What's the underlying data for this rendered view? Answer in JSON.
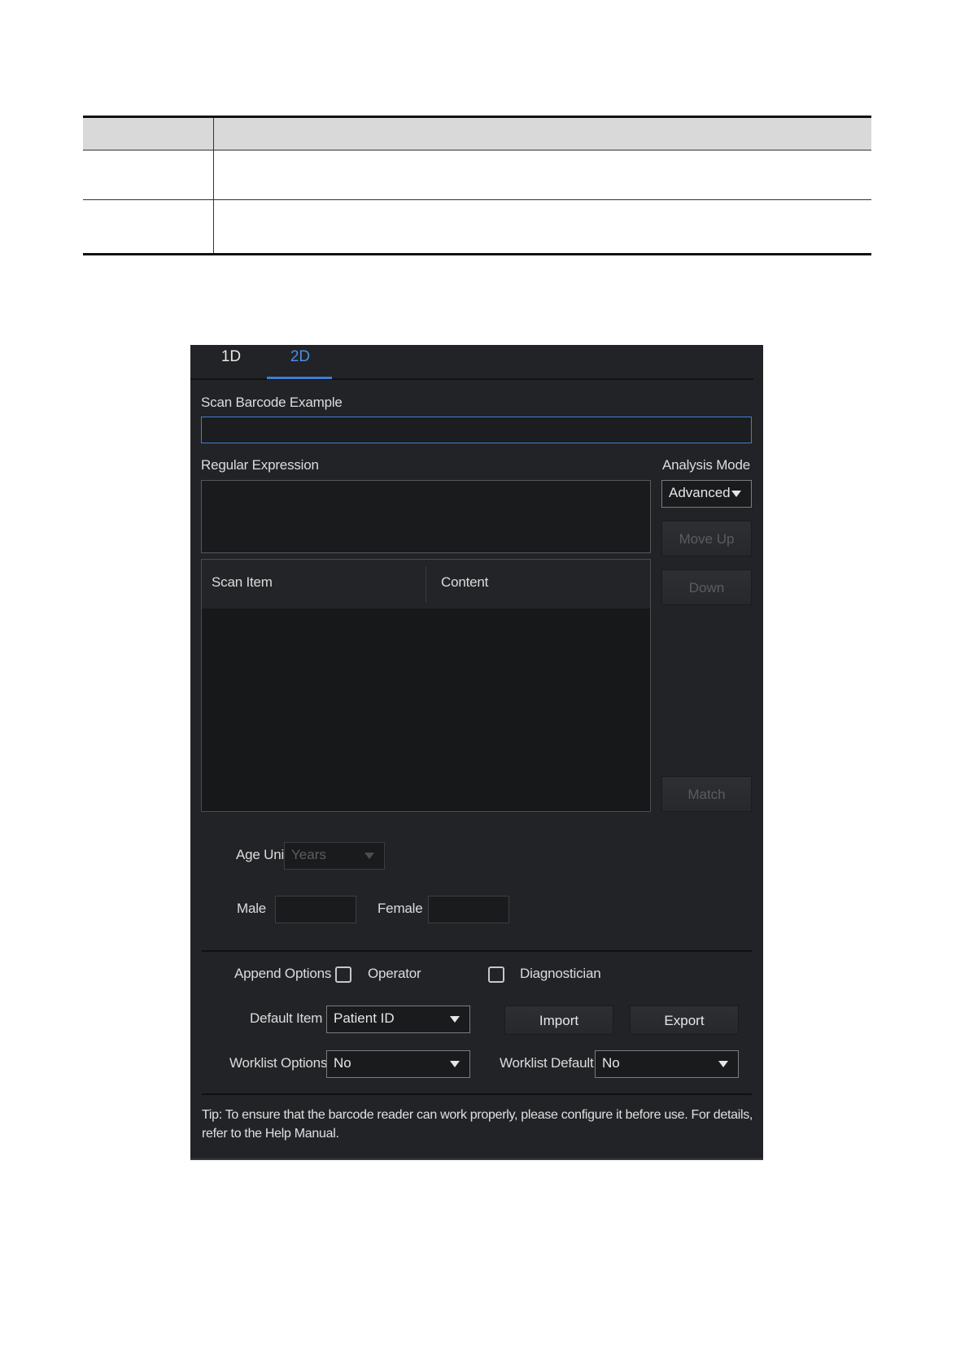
{
  "dialog": {
    "tabs": [
      {
        "label": "1D",
        "active": false
      },
      {
        "label": "2D",
        "active": true
      }
    ],
    "scan_barcode_example_label": "Scan Barcode Example",
    "scan_barcode_example_value": "",
    "regular_expression_label": "Regular Expression",
    "regular_expression_value": "",
    "analysis_mode_label": "Analysis Mode",
    "analysis_mode_value": "Advanced",
    "buttons": {
      "move_up": "Move Up",
      "down": "Down",
      "match": "Match",
      "import": "Import",
      "export": "Export"
    },
    "table": {
      "columns": [
        "Scan Item",
        "Content"
      ],
      "rows": []
    },
    "age_unit_label": "Age Unit",
    "age_unit_value": "Years",
    "male_label": "Male",
    "male_value": "",
    "female_label": "Female",
    "female_value": "",
    "append_options_label": "Append Options",
    "append_options": [
      {
        "label": "Operator",
        "checked": false
      },
      {
        "label": "Diagnostician",
        "checked": false
      }
    ],
    "default_item_label": "Default Item",
    "default_item_value": "Patient ID",
    "worklist_options_label": "Worklist Options",
    "worklist_options_value": "No",
    "worklist_default_label": "Worklist Default",
    "worklist_default_value": "No",
    "tip": "Tip: To ensure that the barcode reader can work properly, please configure it before use. For details, refer to the Help Manual."
  },
  "colors": {
    "dialog_bg": "#222326",
    "accent": "#3d7ed8",
    "text": "#e6e6e6"
  }
}
